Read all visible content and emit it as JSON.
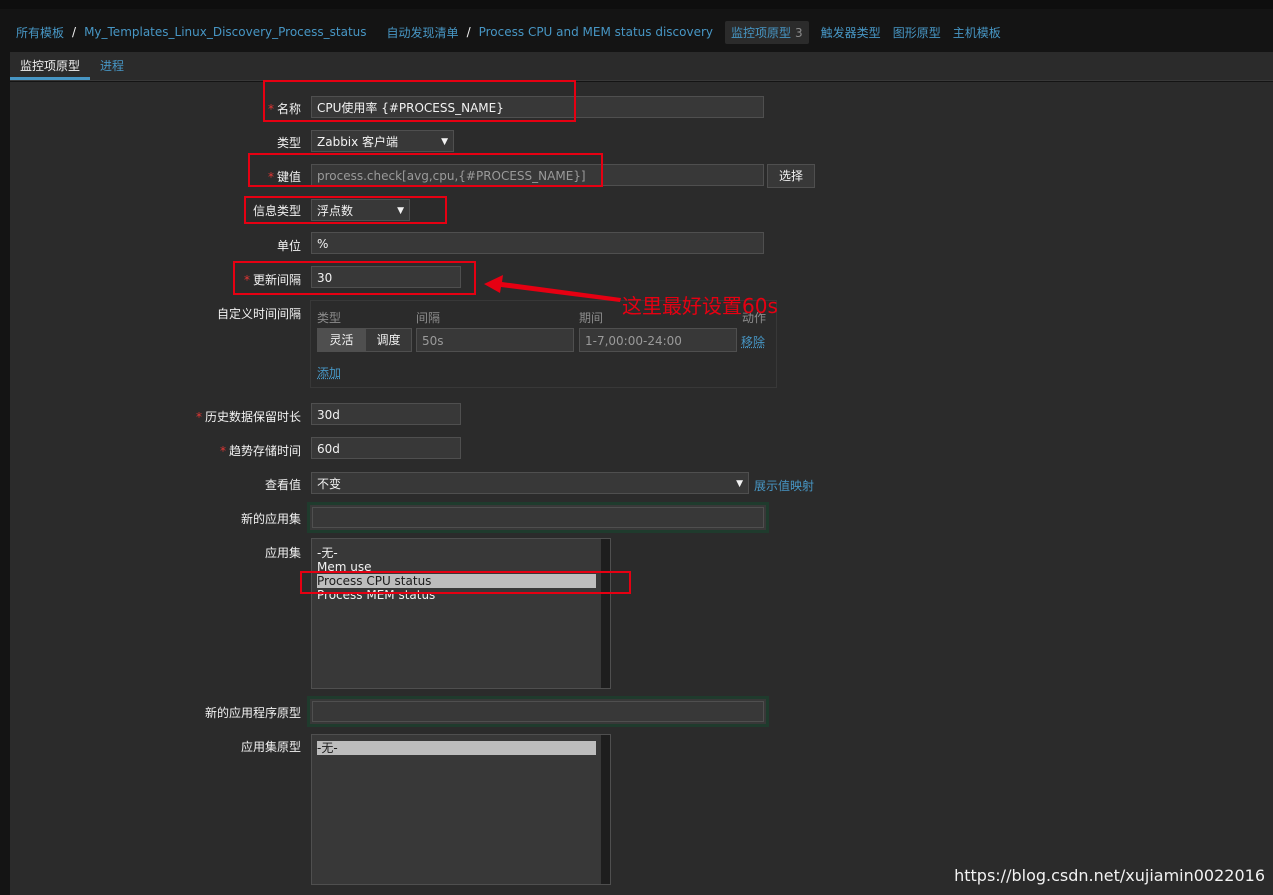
{
  "breadcrumb": {
    "all_templates": "所有模板",
    "template": "My_Templates_Linux_Discovery_Process_status",
    "discovery_list": "自动发现清单",
    "rule": "Process CPU and MEM status discovery",
    "item_prototypes": "监控项原型",
    "item_prototypes_count": "3",
    "trigger_types": "触发器类型",
    "graph_prototypes": "图形原型",
    "host_templates": "主机模板"
  },
  "tabs": {
    "item_prototype": "监控项原型",
    "process": "进程"
  },
  "form": {
    "name_label": "名称",
    "name_value": "CPU使用率 {#PROCESS_NAME}",
    "type_label": "类型",
    "type_value": "Zabbix 客户端",
    "key_label": "键值",
    "key_value": "process.check[avg,cpu,{#PROCESS_NAME}]",
    "select_button": "选择",
    "info_type_label": "信息类型",
    "info_type_value": "浮点数",
    "unit_label": "单位",
    "unit_value": "%",
    "interval_label": "更新间隔",
    "interval_value": "30",
    "custom_interval_label": "自定义时间间隔",
    "custom": {
      "col_type": "类型",
      "col_interval": "间隔",
      "col_period": "期间",
      "col_action": "动作",
      "flexible": "灵活",
      "scheduling": "调度",
      "interval_value": "50s",
      "period_value": "1-7,00:00-24:00",
      "remove": "移除",
      "add": "添加"
    },
    "history_label": "历史数据保留时长",
    "history_value": "30d",
    "trends_label": "趋势存储时间",
    "trends_value": "60d",
    "show_value_label": "查看值",
    "show_value_value": "不变",
    "show_value_link": "展示值映射",
    "new_app_label": "新的应用集",
    "apps_label": "应用集",
    "apps_options": [
      "-无-",
      "Mem use",
      "Process CPU status",
      "Process MEM status"
    ],
    "apps_selected": "Process CPU status",
    "new_app_proto_label": "新的应用程序原型",
    "app_protos_label": "应用集原型",
    "app_protos_options": [
      "-无-"
    ]
  },
  "annotation": {
    "text": "这里最好设置60s"
  },
  "watermark": "https://blog.csdn.net/xujiamin0022016",
  "colors": {
    "link": "#4796c4",
    "required": "#e33734",
    "annotation_red": "#e60012",
    "panel": "#2b2b2b"
  }
}
